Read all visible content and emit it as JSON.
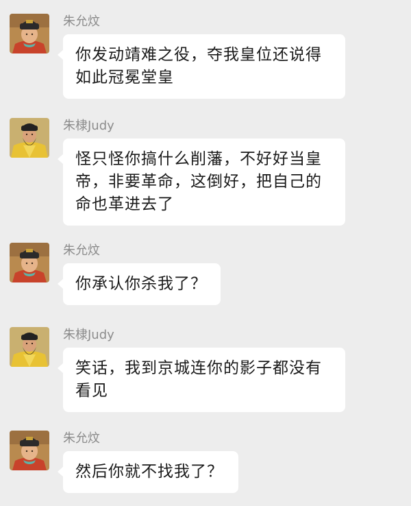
{
  "messages": [
    {
      "sender": "朱允炆",
      "avatar": "jianwen-emperor-avatar",
      "text": "你发动靖难之役，夺我皇位还说得如此冠冕堂皇"
    },
    {
      "sender": "朱棣Judy",
      "avatar": "yongle-emperor-avatar",
      "text": "怪只怪你搞什么削藩，不好好当皇帝，非要革命，这倒好，把自己的命也革进去了"
    },
    {
      "sender": "朱允炆",
      "avatar": "jianwen-emperor-avatar",
      "text": "你承认你杀我了？"
    },
    {
      "sender": "朱棣Judy",
      "avatar": "yongle-emperor-avatar",
      "text": "笑话，我到京城连你的影子都没有看见"
    },
    {
      "sender": "朱允炆",
      "avatar": "jianwen-emperor-avatar",
      "text": "然后你就不找我了？"
    }
  ],
  "colors": {
    "background": "#ededed",
    "bubble": "#ffffff",
    "sender_name": "#8c8c8c"
  }
}
